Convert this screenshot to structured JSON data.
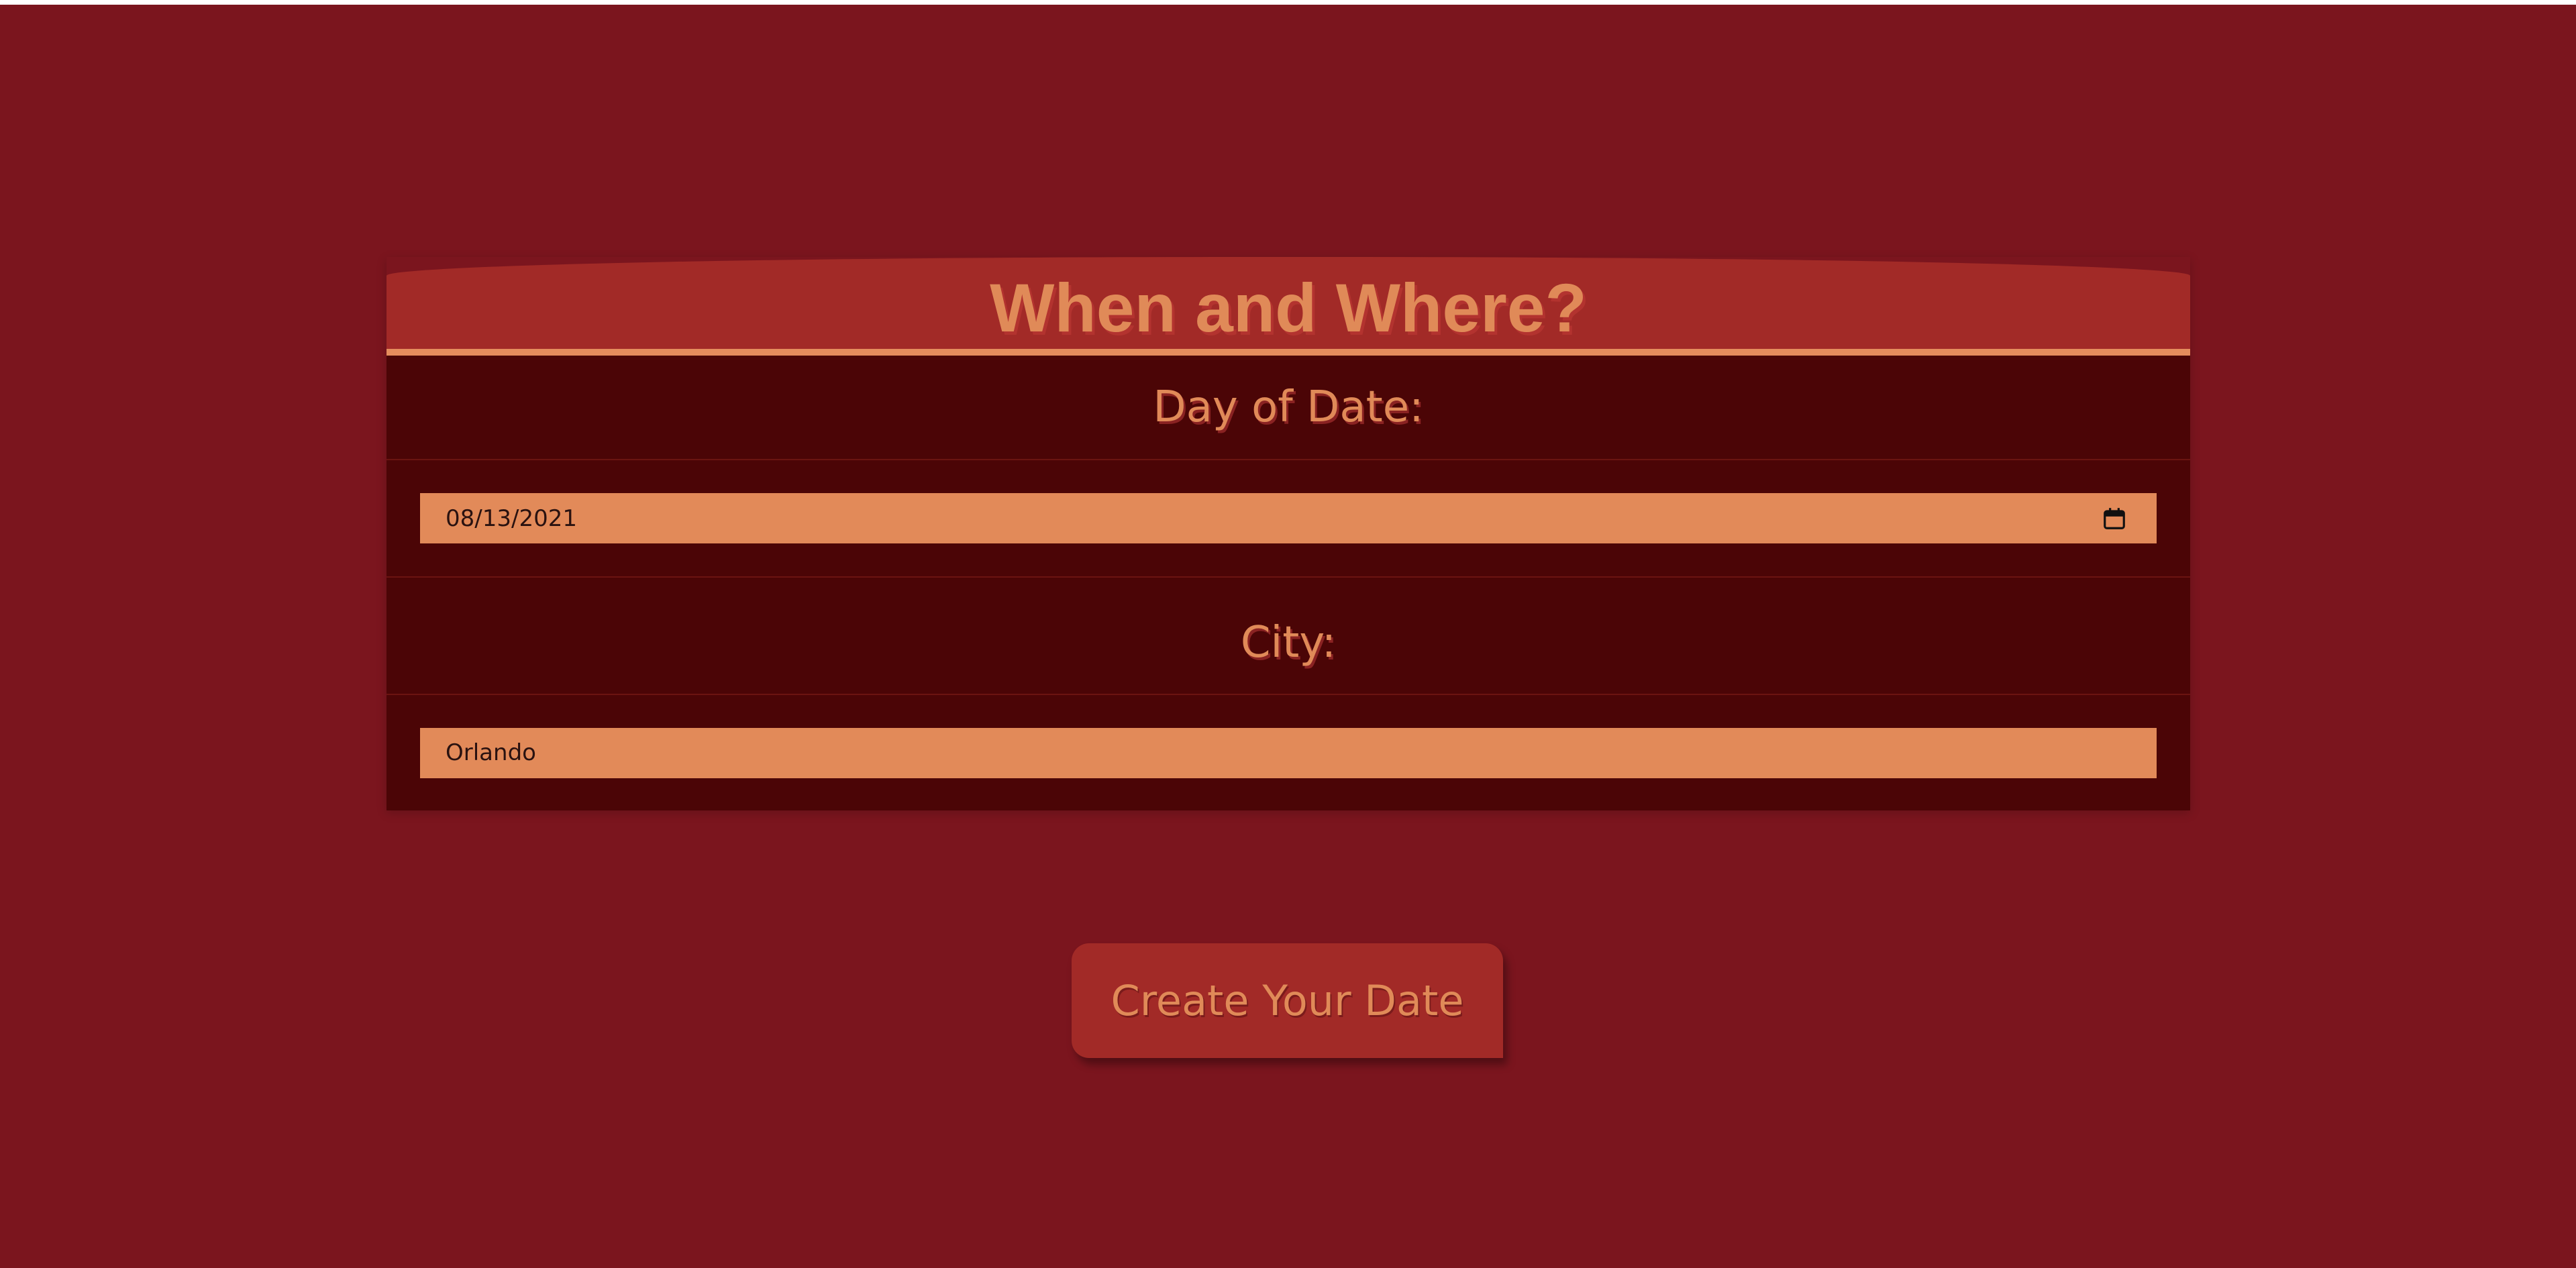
{
  "page": {
    "background_color": "#7b151e"
  },
  "card": {
    "title": "When and Where?",
    "date_label": "Day of Date:",
    "date_value": "08/13/2021",
    "date_picker_icon": "calendar-icon",
    "city_label": "City:",
    "city_value": "Orlando"
  },
  "actions": {
    "create_label": "Create Your Date"
  },
  "colors": {
    "accent": "#e08a58",
    "header": "#a22a27",
    "panel": "#4b0506",
    "input_fill": "#e28a59"
  }
}
